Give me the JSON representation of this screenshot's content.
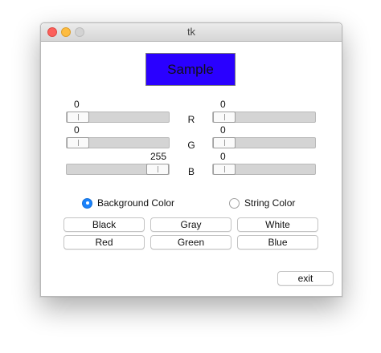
{
  "window": {
    "title": "tk"
  },
  "sample": {
    "label": "Sample",
    "background": "#2a00ff"
  },
  "sliders": {
    "left": {
      "r": 0,
      "g": 0,
      "b": 255
    },
    "right": {
      "r": 0,
      "g": 0,
      "b": 0
    },
    "range": [
      0,
      255
    ]
  },
  "channel_labels": {
    "r": "R",
    "g": "G",
    "b": "B"
  },
  "target": {
    "background_label": "Background Color",
    "string_label": "String Color",
    "selected": "background"
  },
  "colors": {
    "black": "Black",
    "gray": "Gray",
    "white": "White",
    "red": "Red",
    "green": "Green",
    "blue": "Blue"
  },
  "exit_label": "exit",
  "accent": "#1a82fb"
}
